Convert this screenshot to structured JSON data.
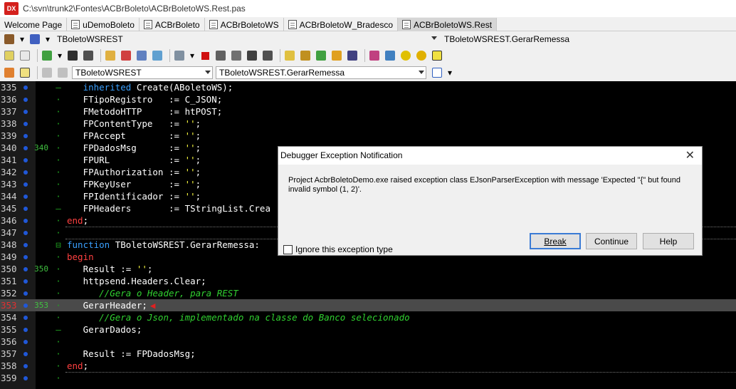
{
  "window": {
    "title": "C:\\svn\\trunk2\\Fontes\\ACBrBoleto\\ACBrBoletoWS.Rest.pas",
    "logo": "DX"
  },
  "tabs": [
    {
      "label": "Welcome Page",
      "active": false
    },
    {
      "label": "uDemoBoleto",
      "active": false
    },
    {
      "label": "ACBrBoleto",
      "active": false
    },
    {
      "label": "ACBrBoletoWS",
      "active": false
    },
    {
      "label": "ACBrBoletoW_Bradesco",
      "active": false
    },
    {
      "label": "ACBrBoletoWS.Rest",
      "active": true
    }
  ],
  "nav_top": {
    "class_combo": "TBoletoWSREST",
    "method_combo": "TBoletoWSREST.GerarRemessa"
  },
  "nav_bottom": {
    "class_combo": "TBoletoWSREST",
    "method_combo": "TBoletoWSREST.GerarRemessa"
  },
  "toolbar_icons": [
    "book-icon",
    "print-icon",
    "view-icon",
    "new-icon",
    "run-icon",
    "save-icon",
    "save-all-icon",
    "open-folder-icon",
    "close-icon",
    "compile-icon",
    "build-icon",
    "step-icon",
    "stop-icon",
    "trace-icon",
    "step-over-icon",
    "run-to-icon",
    "eval-icon",
    "inspect-icon",
    "edit-icon",
    "dollar-icon",
    "refresh-icon",
    "sort-icon",
    "dictionary-icon",
    "folder-icon",
    "settings-icon",
    "info-icon"
  ],
  "editor": {
    "lines": [
      {
        "n": "335",
        "mark": "",
        "fold": "–",
        "code": [
          [
            "   ",
            ""
          ],
          [
            "inherited",
            "kw"
          ],
          [
            " Create(ABoletoWS);",
            ""
          ]
        ]
      },
      {
        "n": "336",
        "mark": "",
        "fold": "·",
        "code": [
          [
            "   FTipoRegistro   := C_JSON;",
            ""
          ]
        ]
      },
      {
        "n": "337",
        "mark": "",
        "fold": "·",
        "code": [
          [
            "   FMetodoHTTP     := htPOST;",
            ""
          ]
        ]
      },
      {
        "n": "338",
        "mark": "",
        "fold": "·",
        "code": [
          [
            "   FPContentType   := ",
            ""
          ],
          [
            "''",
            "str"
          ],
          [
            ";",
            ""
          ]
        ]
      },
      {
        "n": "339",
        "mark": "",
        "fold": "·",
        "code": [
          [
            "   FPAccept        := ",
            ""
          ],
          [
            "''",
            "str"
          ],
          [
            ";",
            ""
          ]
        ]
      },
      {
        "n": "340",
        "mark": "340",
        "fold": "·",
        "code": [
          [
            "   FPDadosMsg      := ",
            ""
          ],
          [
            "''",
            "str"
          ],
          [
            ";",
            ""
          ]
        ]
      },
      {
        "n": "341",
        "mark": "",
        "fold": "·",
        "code": [
          [
            "   FPURL           := ",
            ""
          ],
          [
            "''",
            "str"
          ],
          [
            ";",
            ""
          ]
        ]
      },
      {
        "n": "342",
        "mark": "",
        "fold": "·",
        "code": [
          [
            "   FPAuthorization := ",
            ""
          ],
          [
            "''",
            "str"
          ],
          [
            ";",
            ""
          ]
        ]
      },
      {
        "n": "343",
        "mark": "",
        "fold": "·",
        "code": [
          [
            "   FPKeyUser       := ",
            ""
          ],
          [
            "''",
            "str"
          ],
          [
            ";",
            ""
          ]
        ]
      },
      {
        "n": "344",
        "mark": "",
        "fold": "·",
        "code": [
          [
            "   FPIdentificador := ",
            ""
          ],
          [
            "''",
            "str"
          ],
          [
            ";",
            ""
          ]
        ]
      },
      {
        "n": "345",
        "mark": "",
        "fold": "–",
        "code": [
          [
            "   FPHeaders       := TStringList.Crea",
            ""
          ]
        ]
      },
      {
        "n": "346",
        "mark": "",
        "fold": "·",
        "code": [
          [
            "end",
            "red"
          ],
          [
            ";",
            ""
          ]
        ]
      },
      {
        "n": "347",
        "mark": "",
        "fold": "·",
        "code": [
          [
            "",
            ""
          ]
        ]
      },
      {
        "n": "348",
        "mark": "",
        "fold": "⊟",
        "code": [
          [
            "function",
            "kw"
          ],
          [
            " TBoletoWSREST.GerarRemessa:",
            ""
          ]
        ]
      },
      {
        "n": "349",
        "mark": "",
        "fold": "·",
        "code": [
          [
            "begin",
            "red"
          ]
        ]
      },
      {
        "n": "350",
        "mark": "350",
        "fold": "·",
        "code": [
          [
            "   Result := ",
            ""
          ],
          [
            "''",
            "str"
          ],
          [
            ";",
            ""
          ]
        ]
      },
      {
        "n": "351",
        "mark": "",
        "fold": "·",
        "code": [
          [
            "   httpsend.Headers.Clear;",
            ""
          ]
        ]
      },
      {
        "n": "352",
        "mark": "",
        "fold": "·",
        "code": [
          [
            "      //Gera o Header, para REST",
            "cm"
          ]
        ]
      },
      {
        "n": "353",
        "mark": "353",
        "fold": "·",
        "code": [
          [
            "   GerarHeader;",
            ""
          ]
        ]
      },
      {
        "n": "354",
        "mark": "",
        "fold": "·",
        "code": [
          [
            "      //Gera o Json, implementado na classe do Banco selecionado",
            "cm"
          ]
        ]
      },
      {
        "n": "355",
        "mark": "",
        "fold": "–",
        "code": [
          [
            "   GerarDados;",
            ""
          ]
        ]
      },
      {
        "n": "356",
        "mark": "",
        "fold": "·",
        "code": [
          [
            "",
            ""
          ]
        ]
      },
      {
        "n": "357",
        "mark": "",
        "fold": "·",
        "code": [
          [
            "   Result := FPDadosMsg;",
            ""
          ]
        ]
      },
      {
        "n": "358",
        "mark": "",
        "fold": "·",
        "code": [
          [
            "end",
            "red"
          ],
          [
            ";",
            ""
          ]
        ]
      },
      {
        "n": "359",
        "mark": "",
        "fold": "·",
        "code": [
          [
            "",
            ""
          ]
        ]
      }
    ],
    "current_line": "353"
  },
  "dialog": {
    "title": "Debugger Exception Notification",
    "message": "Project AcbrBoletoDemo.exe raised exception class EJsonParserException with message 'Expected \"{\" but found invalid symbol (1, 2)'.",
    "ignore_label": "Ignore this exception type",
    "break_label": "Break",
    "continue_label": "Continue",
    "help_label": "Help"
  }
}
